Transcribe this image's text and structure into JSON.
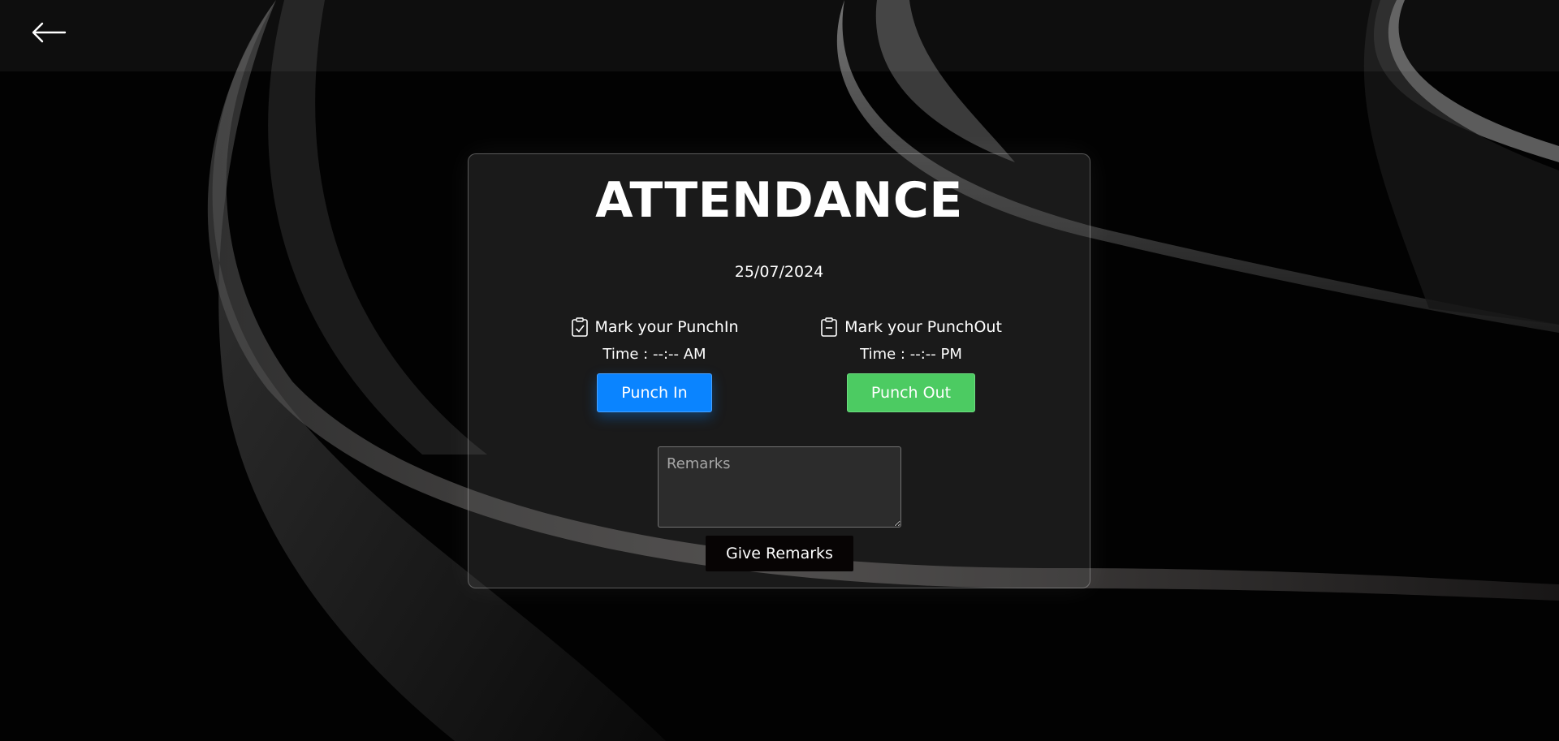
{
  "header": {
    "back_icon": "arrow-left-icon"
  },
  "attendance": {
    "title": "ATTENDANCE",
    "date": "25/07/2024",
    "punch_in": {
      "icon": "clipboard-check-icon",
      "label": "Mark your PunchIn",
      "time": "Time : --:-- AM",
      "button_label": "Punch In",
      "button_color": "#0a84ff"
    },
    "punch_out": {
      "icon": "clipboard-icon",
      "label": "Mark your PunchOut",
      "time": "Time : --:-- PM",
      "button_label": "Punch Out",
      "button_color": "#4ccb62"
    },
    "remarks": {
      "placeholder": "Remarks",
      "value": ""
    },
    "give_remarks_label": "Give Remarks"
  },
  "colors": {
    "background": "#020202",
    "give_remarks_button": "#070404"
  }
}
